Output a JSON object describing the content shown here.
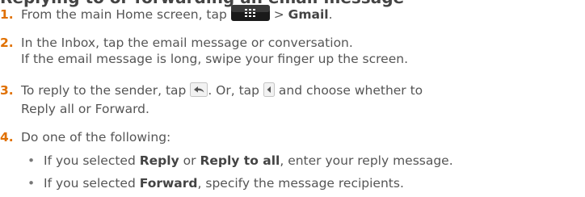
{
  "heading": "Replying to or forwarding an email message",
  "steps": [
    {
      "num": "1.",
      "a": "From the main Home screen, tap",
      "sep": ">",
      "b": "Gmail",
      "end": "."
    },
    {
      "num": "2.",
      "l1": "In the Inbox, tap the email message or conversation.",
      "l2": "If the email message is long, swipe your finger up the screen."
    },
    {
      "num": "3.",
      "a": "To reply to the sender, tap",
      "b": ". Or, tap",
      "c": "and choose whether to",
      "l2": "Reply all or Forward."
    },
    {
      "num": "4.",
      "l1": "Do one of the following:"
    }
  ],
  "bullets": [
    {
      "a": "If you selected",
      "b": "Reply",
      "c": "or",
      "d": "Reply to all",
      "e": ", enter your reply message."
    },
    {
      "a": "If you selected",
      "b": "Forward",
      "e": ", specify the message recipients."
    }
  ],
  "icons": [
    "all-apps-icon",
    "reply-arrow-icon",
    "menu-arrow-icon"
  ],
  "colors": {
    "accent": "#e07000",
    "text": "#555555",
    "bold_text": "#444444"
  }
}
